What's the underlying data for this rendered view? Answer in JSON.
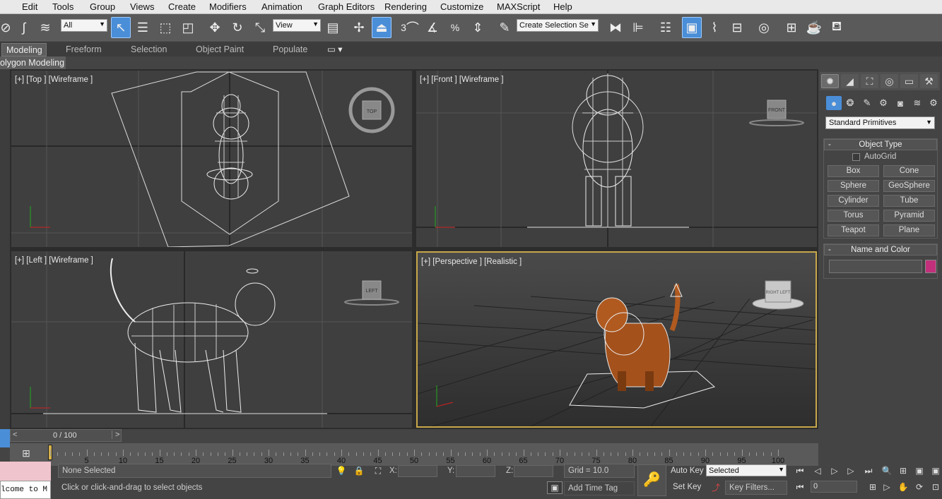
{
  "menu": [
    "Edit",
    "Tools",
    "Group",
    "Views",
    "Create",
    "Modifiers",
    "Animation",
    "Graph Editors",
    "Rendering",
    "Customize",
    "MAXScript",
    "Help"
  ],
  "toolbar": {
    "filter_value": "All",
    "refcoord_value": "View",
    "named_selection_value": "Create Selection Se",
    "snap_label": "3",
    "angle_snap_label": "%"
  },
  "ribbon": {
    "tabs": [
      "Modeling",
      "Freeform",
      "Selection",
      "Object Paint",
      "Populate"
    ],
    "active_tab": "Modeling",
    "sub_label": "olygon Modeling"
  },
  "viewports": [
    {
      "id": "top",
      "label": "[+] [Top ] [Wireframe ]",
      "cube": "TOP"
    },
    {
      "id": "front",
      "label": "[+] [Front ] [Wireframe ]",
      "cube": "FRONT"
    },
    {
      "id": "left",
      "label": "[+] [Left ] [Wireframe ]",
      "cube": "LEFT"
    },
    {
      "id": "perspective",
      "label": "[+] [Perspective ] [Realistic ]",
      "cube": "RIGHT  LEFT"
    }
  ],
  "command_panel": {
    "category_dropdown": "Standard Primitives",
    "object_type": {
      "title": "Object Type",
      "autogrid": "AutoGrid",
      "buttons": [
        "Box",
        "Cone",
        "Sphere",
        "GeoSphere",
        "Cylinder",
        "Tube",
        "Torus",
        "Pyramid",
        "Teapot",
        "Plane"
      ]
    },
    "name_color": {
      "title": "Name and Color",
      "swatch_color": "#c2307c"
    }
  },
  "timeline": {
    "frame_counter": "0 / 100",
    "ticks": [
      "5",
      "10",
      "15",
      "20",
      "25",
      "30",
      "35",
      "40",
      "45",
      "50",
      "55",
      "60",
      "65",
      "70",
      "75",
      "80",
      "85",
      "90",
      "95",
      "100"
    ]
  },
  "status": {
    "selection": "None Selected",
    "prompt": "Click or click-and-drag to select objects",
    "maxscript": "lcome to M",
    "x_label": "X:",
    "y_label": "Y:",
    "z_label": "Z:",
    "grid": "Grid = 10.0",
    "add_time_tag": "Add Time Tag",
    "auto_key": "Auto Key",
    "set_key": "Set Key",
    "key_mode": "Selected",
    "key_filters": "Key Filters...",
    "current_frame": "0"
  }
}
